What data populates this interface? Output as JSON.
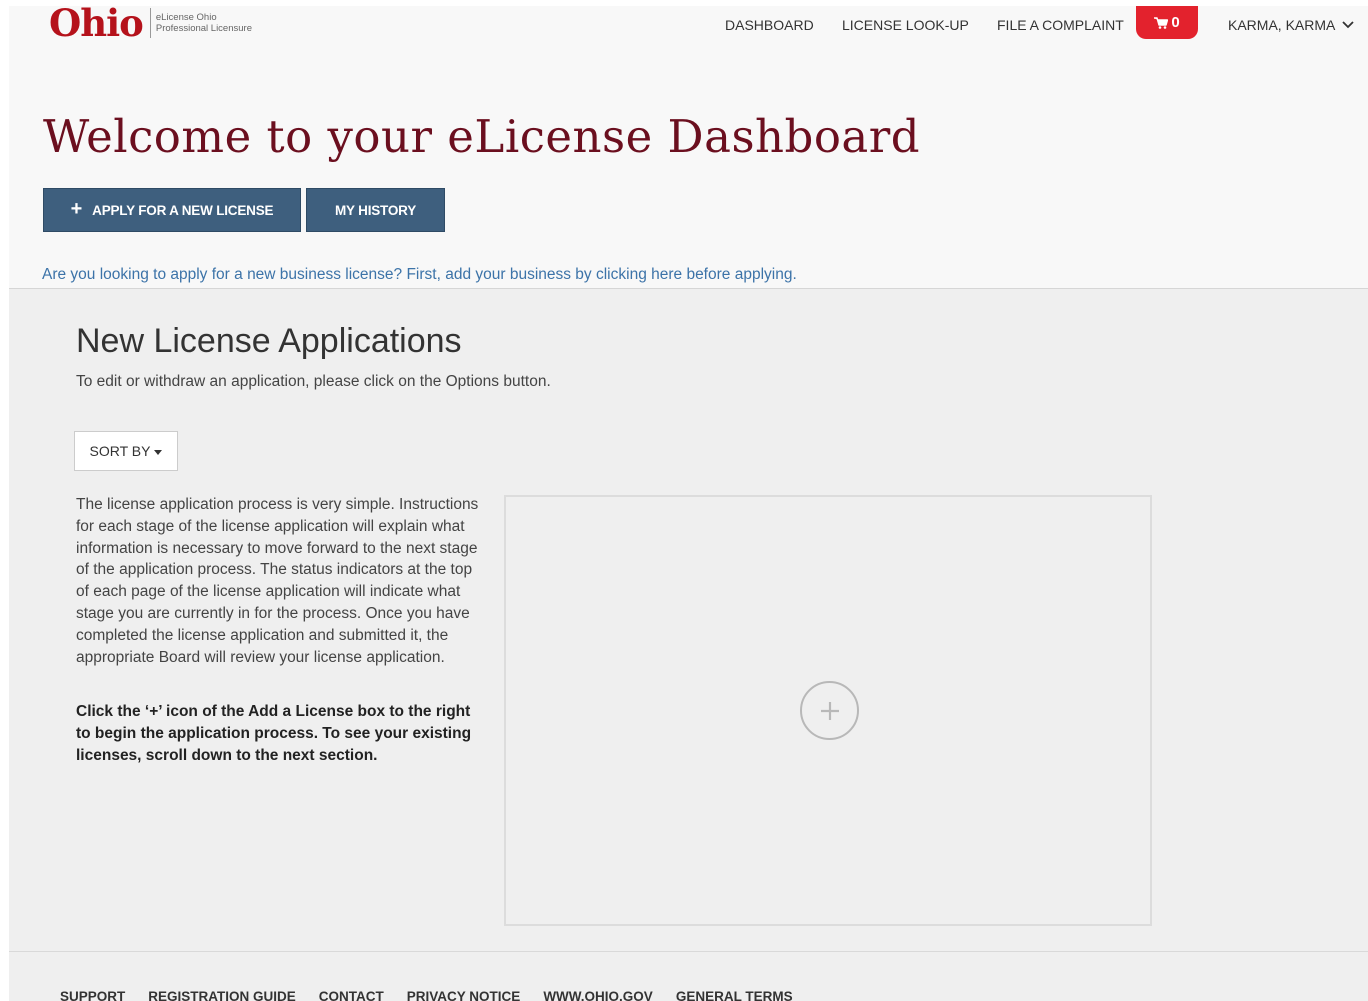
{
  "logo": {
    "word": "Ohio",
    "sub_line1": "eLicense Ohio",
    "sub_line2": "Professional Licensure"
  },
  "nav": {
    "dashboard": "DASHBOARD",
    "license_lookup": "LICENSE LOOK-UP",
    "file_complaint": "FILE A COMPLAINT",
    "cart_count": "0",
    "user_name": "KARMA, KARMA"
  },
  "hero": {
    "title": "Welcome to your eLicense Dashboard",
    "apply_button": "APPLY FOR A NEW LICENSE",
    "history_button": "MY HISTORY",
    "business_link": "Are you looking to apply for a new business license? First, add your business by clicking here before applying."
  },
  "applications": {
    "title": "New License Applications",
    "subtitle": "To edit or withdraw an application, please click on the Options button.",
    "sort_label": "SORT BY",
    "intro": "The license application process is very simple. Instructions for each stage of the license application will explain what information is necessary to move forward to the next stage of the application process. The status indicators at the top of each page of the license application will indicate what stage you are currently in for the process. Once you have completed the license application and submitted it, the appropriate Board will review your license application.",
    "intro_bold": "Click the ‘+’ icon of the Add a License box to the right to begin the application process. To see your existing licenses, scroll down to the next section."
  },
  "footer": {
    "links": [
      "SUPPORT",
      "REGISTRATION GUIDE",
      "CONTACT",
      "PRIVACY NOTICE",
      "WWW.OHIO.GOV",
      "GENERAL TERMS"
    ]
  },
  "colors": {
    "brand_red": "#b5121b",
    "title_maroon": "#6b0f1f",
    "button_blue": "#3e5f7e",
    "link_blue": "#3c73a8",
    "cart_red": "#e3222d"
  },
  "icons": {
    "cart": "cart-icon",
    "user_menu": "chevron-down-icon",
    "apply": "plus-icon",
    "add_license": "plus-circle-icon"
  }
}
